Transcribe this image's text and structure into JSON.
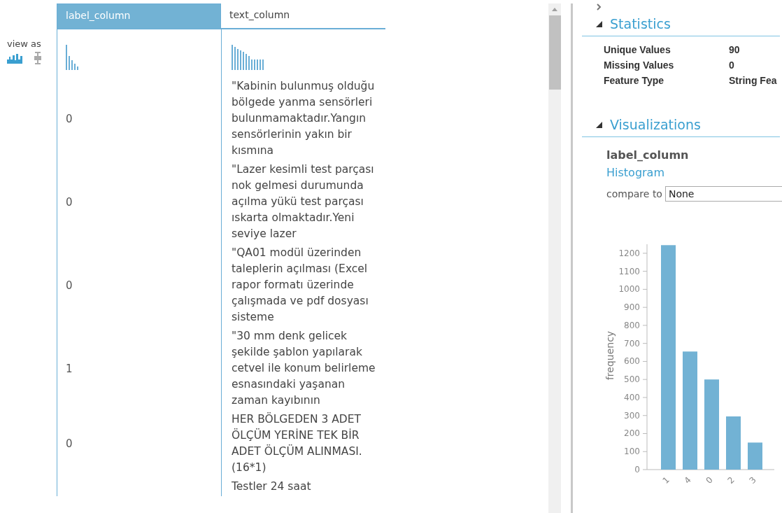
{
  "view_as": {
    "label": "view as",
    "modes": [
      {
        "kind": "histogram",
        "selected": true
      },
      {
        "kind": "boxplot",
        "selected": false
      }
    ]
  },
  "table": {
    "columns": [
      {
        "label": "label_column",
        "selected": true
      },
      {
        "label": "text_column",
        "selected": false
      }
    ],
    "rows": [
      {
        "label": "0",
        "text": "\"Kabinin bulunmuş olduğu bölgede yanma sensörleri bulunmamaktadır.Yangın sensörlerinin yakın bir kısmına"
      },
      {
        "label": "0",
        "text": "\"Lazer kesimli test parçası nok gelmesi durumunda açılma yükü test parçası ıskarta olmaktadır.Yeni seviye lazer"
      },
      {
        "label": "0",
        "text": "\"QA01 modül üzerinden taleplerin açılması (Excel rapor formatı üzerinde çalışmada ve pdf dosyası sisteme"
      },
      {
        "label": "1",
        "text": "\"30 mm denk gelicek şekilde şablon yapılarak cetvel ile konum belirleme esnasındaki yaşanan zaman kayıbının"
      },
      {
        "label": "0",
        "text": "HER BÖLGEDEN 3 ADET ÖLÇÜM YERİNE TEK BİR ADET ÖLÇÜM ALINMASI. (16*1)"
      },
      {
        "label": "",
        "text": "Testler 24 saat"
      }
    ]
  },
  "panel": {
    "sections": [
      {
        "kind": "statistics",
        "title": "Statistics",
        "expanded": true,
        "rows": [
          {
            "name": "Unique Values",
            "value": "90"
          },
          {
            "name": "Missing Values",
            "value": "0"
          },
          {
            "name": "Feature Type",
            "value": "String Fea"
          }
        ]
      },
      {
        "kind": "visualizations",
        "title": "Visualizations",
        "expanded": true,
        "column": "label_column",
        "link": "Histogram",
        "compare_label": "compare to",
        "compare_value": "None",
        "chart_data": {
          "type": "bar",
          "ylabel": "frequency",
          "categories": [
            "1",
            "4",
            "0",
            "2",
            "3"
          ],
          "values": [
            1245,
            655,
            500,
            295,
            150
          ],
          "ylim": [
            0,
            1250
          ],
          "yticks": [
            0,
            100,
            200,
            300,
            400,
            500,
            600,
            700,
            800,
            900,
            1000,
            1100,
            1200
          ]
        }
      }
    ]
  }
}
